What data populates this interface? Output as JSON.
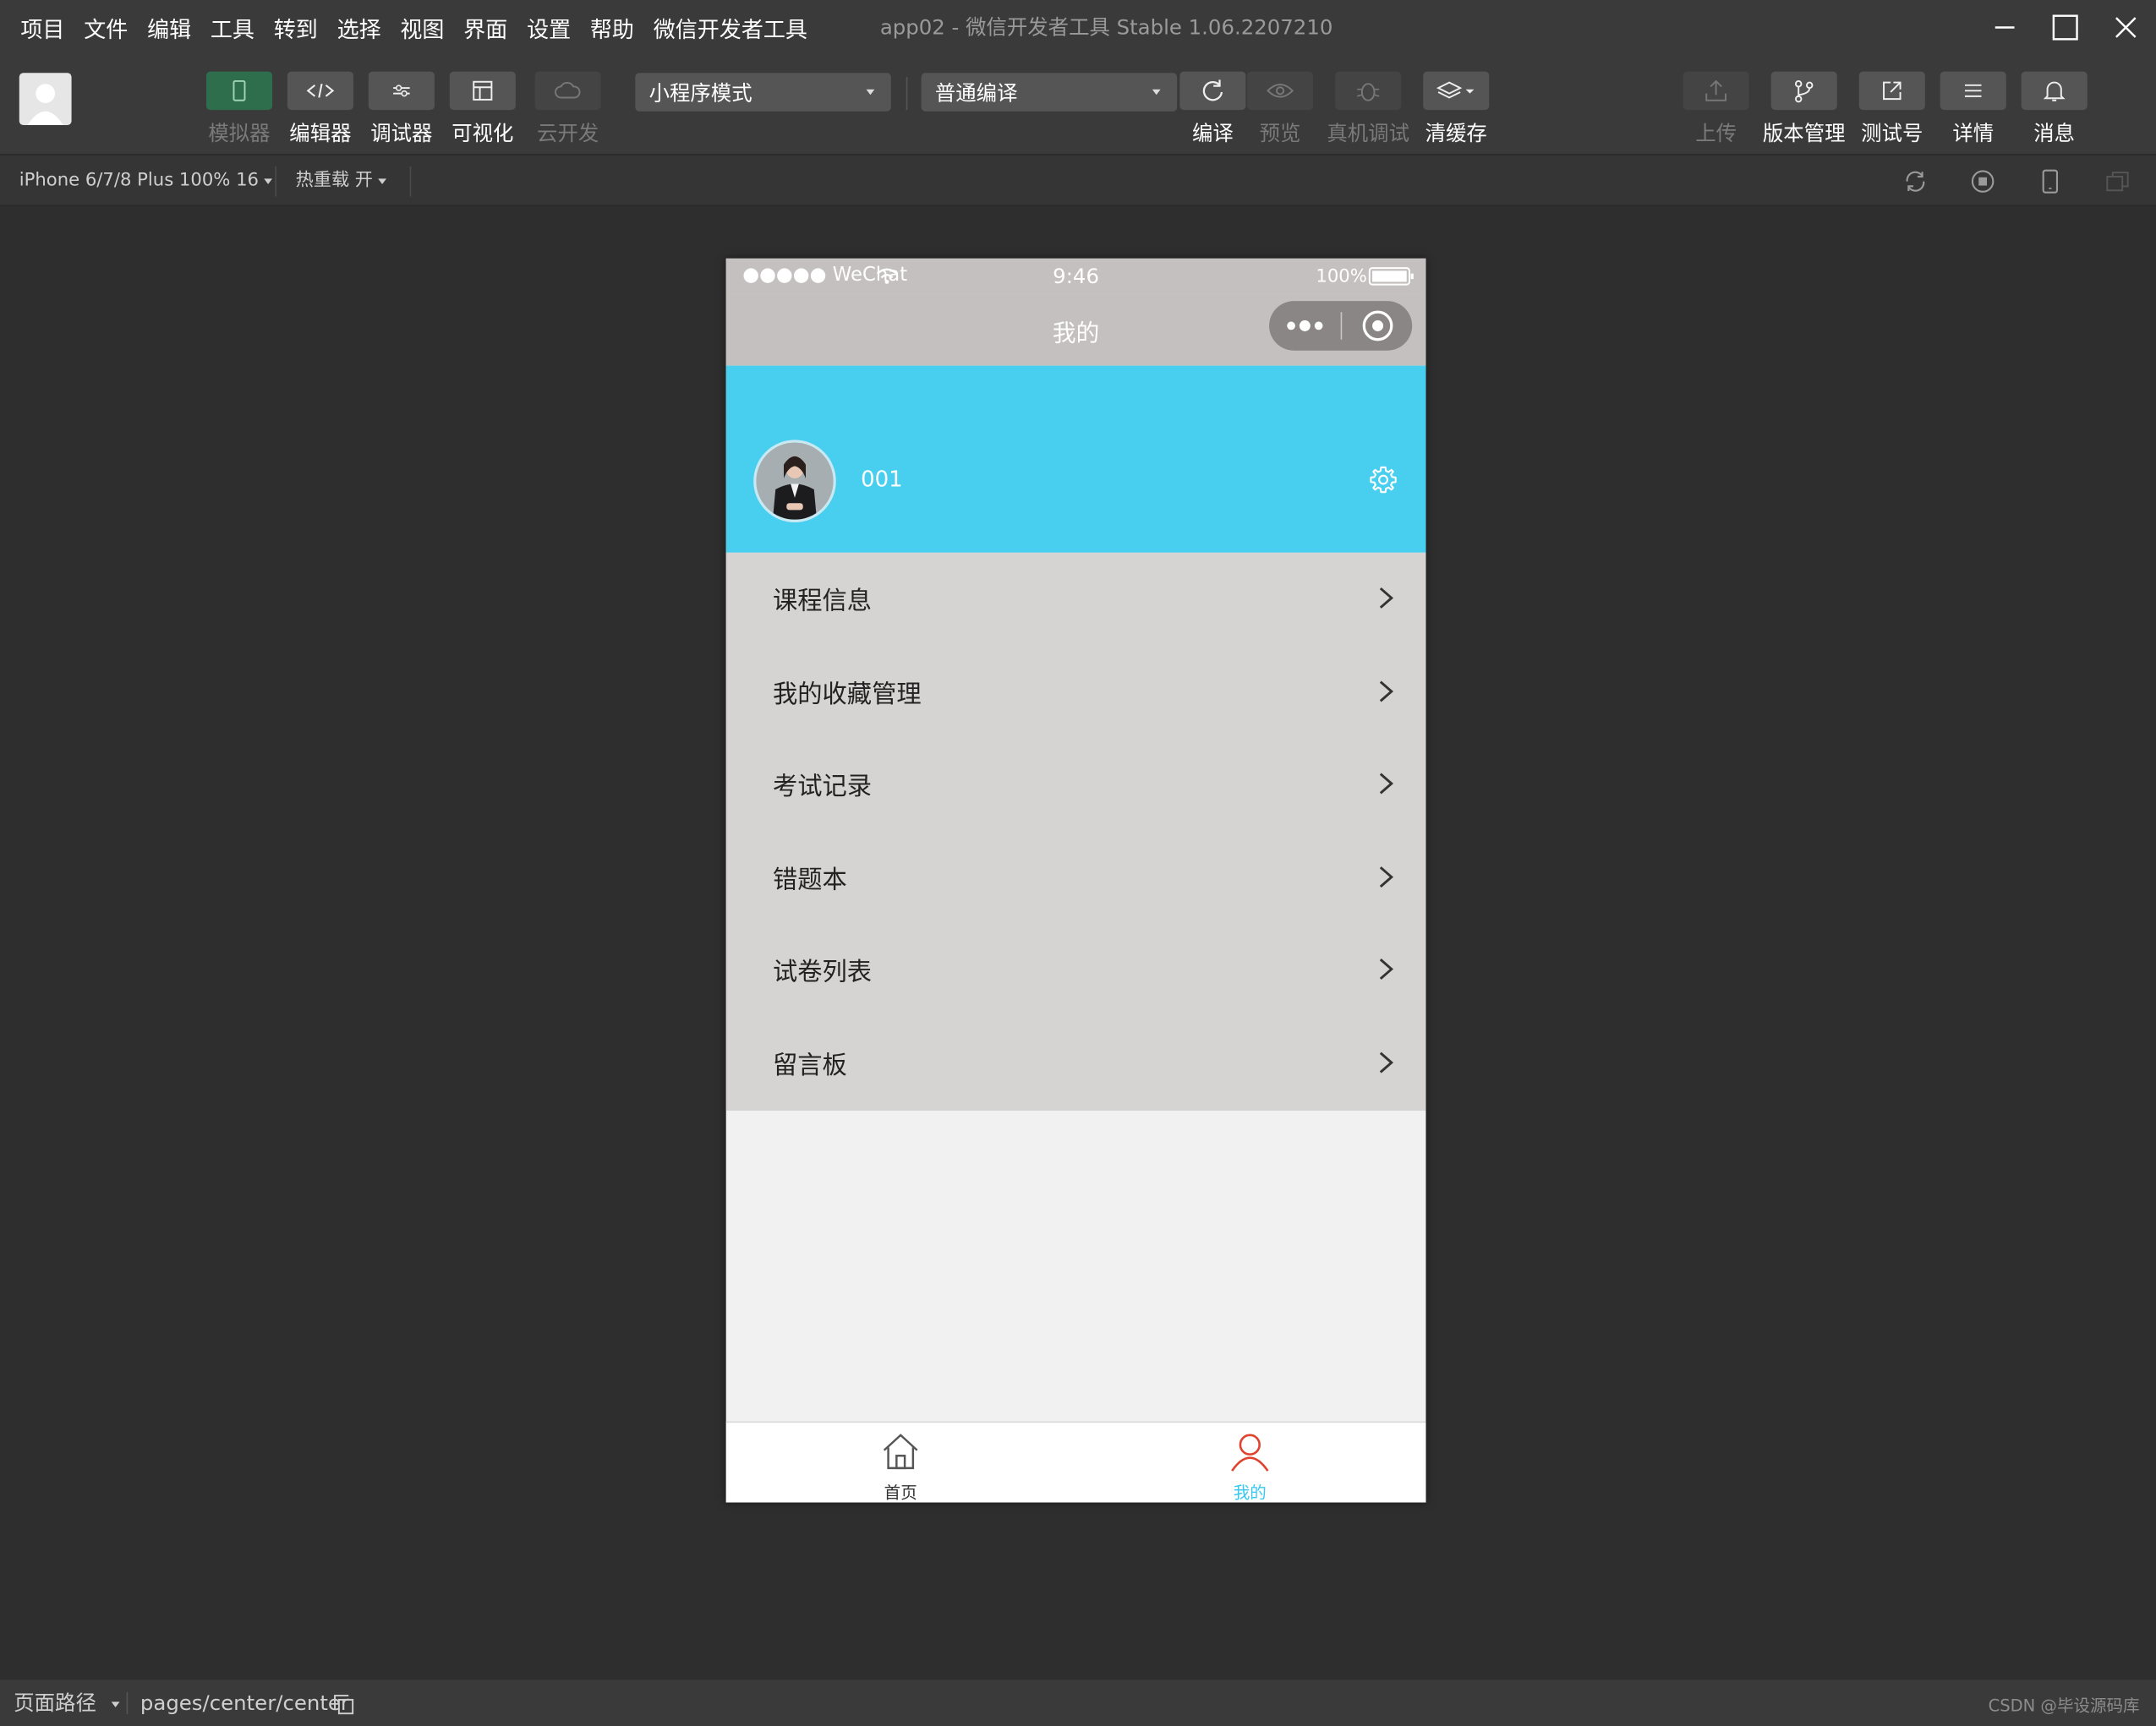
{
  "menubar": {
    "items": [
      "项目",
      "文件",
      "编辑",
      "工具",
      "转到",
      "选择",
      "视图",
      "界面",
      "设置",
      "帮助",
      "微信开发者工具"
    ],
    "window_title": "app02 - 微信开发者工具 Stable 1.06.2207210"
  },
  "toolbar": {
    "left_tools": [
      {
        "label": "模拟器",
        "icon": "phone-icon",
        "state": "active"
      },
      {
        "label": "编辑器",
        "icon": "code-icon",
        "state": "normal"
      },
      {
        "label": "调试器",
        "icon": "debug-icon",
        "state": "normal"
      },
      {
        "label": "可视化",
        "icon": "layout-icon",
        "state": "normal"
      },
      {
        "label": "云开发",
        "icon": "cloud-icon",
        "state": "disabled"
      }
    ],
    "mode_select": "小程序模式",
    "compile_select": "普通编译",
    "center_tools": [
      {
        "label": "编译",
        "icon": "refresh-icon",
        "state": "normal"
      },
      {
        "label": "预览",
        "icon": "eye-icon",
        "state": "disabled"
      },
      {
        "label": "真机调试",
        "icon": "bug-icon",
        "state": "disabled"
      },
      {
        "label": "清缓存",
        "icon": "layers-icon",
        "state": "normal"
      }
    ],
    "right_tools": [
      {
        "label": "上传",
        "icon": "upload-icon",
        "state": "disabled"
      },
      {
        "label": "版本管理",
        "icon": "branch-icon",
        "state": "normal"
      },
      {
        "label": "测试号",
        "icon": "external-link-icon",
        "state": "normal"
      },
      {
        "label": "详情",
        "icon": "list-icon",
        "state": "normal"
      },
      {
        "label": "消息",
        "icon": "bell-icon",
        "state": "normal"
      }
    ]
  },
  "subbar": {
    "device": "iPhone 6/7/8 Plus 100% 16",
    "hot_reload": "热重载 开"
  },
  "phone": {
    "status": {
      "carrier": "●●●●● WeChat",
      "time": "9:46",
      "battery": "100%"
    },
    "nav_title": "我的",
    "username": "001",
    "menu": [
      "课程信息",
      "我的收藏管理",
      "考试记录",
      "错题本",
      "试卷列表",
      "留言板"
    ],
    "tabs": [
      {
        "label": "首页",
        "icon": "home-icon",
        "active": false
      },
      {
        "label": "我的",
        "icon": "user-icon",
        "active": true
      }
    ]
  },
  "bottombar": {
    "path_label": "页面路径",
    "path": "pages/center/center"
  },
  "watermark": "CSDN @毕设源码库",
  "colors": {
    "header_blue": "#48cff0",
    "tab_active_text": "#36c8f0",
    "tab_active_icon": "#e0442f",
    "simulator_green": "#2f6e4c"
  }
}
